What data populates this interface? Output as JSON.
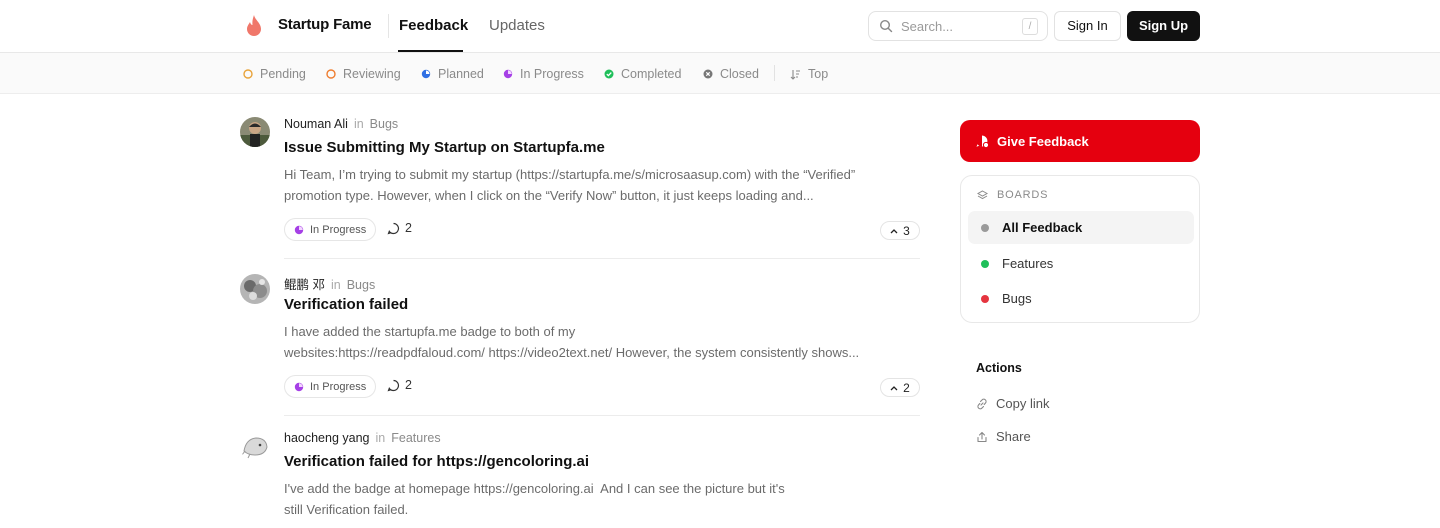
{
  "header": {
    "brand": "Startup Fame",
    "nav": {
      "feedback": "Feedback",
      "updates": "Updates"
    },
    "search": {
      "placeholder": "Search...",
      "shortcut": "/"
    },
    "sign_in": "Sign In",
    "sign_up": "Sign Up"
  },
  "filters": [
    {
      "label": "Pending",
      "icon": "pending-circle-icon",
      "color": "#e8a33a"
    },
    {
      "label": "Reviewing",
      "icon": "reviewing-circle-icon",
      "color": "#ef7d2f"
    },
    {
      "label": "Planned",
      "icon": "planned-icon",
      "color": "#2f6fe4"
    },
    {
      "label": "In Progress",
      "icon": "in-progress-icon",
      "color": "#a640e6"
    },
    {
      "label": "Completed",
      "icon": "completed-check-icon",
      "color": "#1fbf5a"
    },
    {
      "label": "Closed",
      "icon": "closed-x-icon",
      "color": "#777777"
    },
    {
      "label": "Top",
      "icon": "sort-icon",
      "color": "#8a8a8a"
    }
  ],
  "posts": [
    {
      "author": "Nouman Ali",
      "in": "in",
      "board": "Bugs",
      "title": "Issue Submitting My Startup on Startupfa.me",
      "body_lines": [
        "Hi Team, I’m trying to submit my startup (https://startupfa.me/s/microsaasup.com) with the “Verified”",
        "promotion type. However, when I click on the “Verify Now” button, it just keeps loading and..."
      ],
      "status": "In Progress",
      "comments": "2",
      "votes": "3"
    },
    {
      "author": "鲲鹏 邓",
      "in": "in",
      "board": "Bugs",
      "title": "Verification failed",
      "body_lines": [
        "I have added the startupfa.me badge to both of my",
        "websites:https://readpdfaloud.com/ https://video2text.net/ However, the system consistently shows..."
      ],
      "status": "In Progress",
      "comments": "2",
      "votes": "2"
    },
    {
      "author": "haocheng yang",
      "in": "in",
      "board": "Features",
      "title": "Verification failed for https://gencoloring.ai",
      "body_lines": [
        "I've add the badge at homepage https://gencoloring.ai  And I can see the picture but it's",
        "still Verification failed."
      ]
    }
  ],
  "sidebar": {
    "give_feedback": "Give Feedback",
    "boards_title": "BOARDS",
    "boards": [
      {
        "label": "All Feedback",
        "color": "#9a9a9a"
      },
      {
        "label": "Features",
        "color": "#1fbf5a"
      },
      {
        "label": "Bugs",
        "color": "#e5343f"
      }
    ],
    "actions_title": "Actions",
    "actions": [
      {
        "label": "Copy link",
        "icon": "link-icon"
      },
      {
        "label": "Share",
        "icon": "share-icon"
      }
    ]
  },
  "colors": {
    "accent_red": "#e5000f",
    "dark": "#111111"
  }
}
